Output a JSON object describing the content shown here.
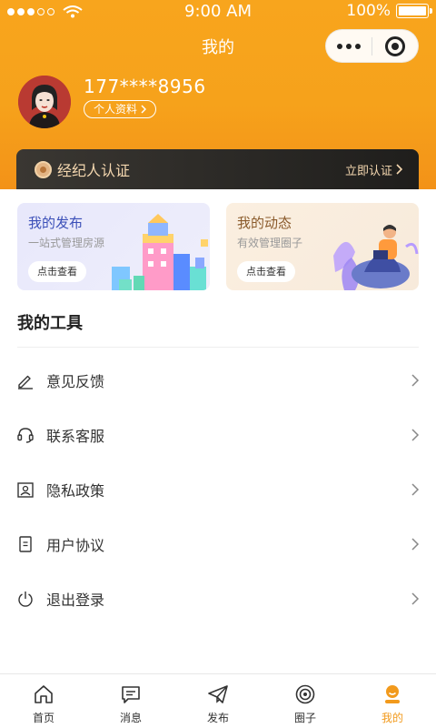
{
  "status_bar": {
    "time": "9:00 AM",
    "battery": "100%",
    "signal_bars": 5,
    "signal_filled": 3
  },
  "nav": {
    "title": "我的"
  },
  "user": {
    "phone": "177****8956",
    "profile_label": "个人资料"
  },
  "certification": {
    "title": "经纪人认证",
    "action": "立即认证"
  },
  "cards": [
    {
      "title": "我的发布",
      "subtitle": "一站式管理房源",
      "button": "点击查看"
    },
    {
      "title": "我的动态",
      "subtitle": "有效管理圈子",
      "button": "点击查看"
    }
  ],
  "tools": {
    "title": "我的工具",
    "items": [
      {
        "label": "意见反馈",
        "icon": "edit-icon"
      },
      {
        "label": "联系客服",
        "icon": "headset-icon"
      },
      {
        "label": "隐私政策",
        "icon": "privacy-icon"
      },
      {
        "label": "用户协议",
        "icon": "document-icon"
      },
      {
        "label": "退出登录",
        "icon": "power-icon"
      }
    ]
  },
  "tabbar": {
    "items": [
      {
        "label": "首页",
        "icon": "home-icon",
        "active": false
      },
      {
        "label": "消息",
        "icon": "message-icon",
        "active": false
      },
      {
        "label": "发布",
        "icon": "send-icon",
        "active": false
      },
      {
        "label": "圈子",
        "icon": "circle-icon",
        "active": false
      },
      {
        "label": "我的",
        "icon": "profile-icon",
        "active": true
      }
    ]
  },
  "colors": {
    "accent": "#f29a1c",
    "header_top": "#f8a51d",
    "header_bottom": "#f39218",
    "cert_text": "#f5d8b0"
  }
}
